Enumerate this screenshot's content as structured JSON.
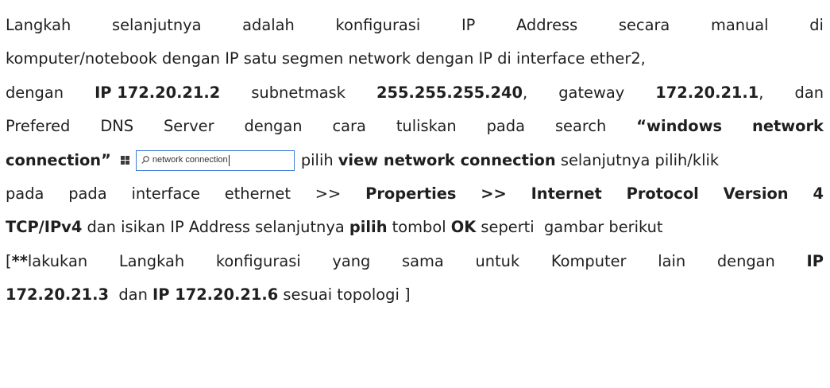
{
  "lines": [
    [
      "Langkah",
      "selanjutnya",
      "adalah",
      "konfigurasi",
      "IP",
      "Address",
      "secara",
      "manual",
      "di"
    ],
    "komputer/notebook dengan IP satu segmen network dengan IP di interface ether2,",
    [
      "dengan",
      "IP 172.20.21.2",
      "subnetmask",
      "255.255.255.240,",
      "gateway",
      "172.20.21.1,",
      "dan"
    ],
    [
      "Prefered",
      "DNS",
      "Server",
      "dengan",
      "cara",
      "tuliskan",
      "pada",
      "search",
      "“windows",
      "network"
    ],
    {
      "before": "connection”",
      "search_text": "network connection",
      "after_bold": "pilih view network connection",
      "after": "selanjutnya pilih/klik"
    },
    [
      "pada",
      "pada",
      "interface",
      "ethernet",
      ">>",
      "Properties >> Internet Protocol Version",
      "4"
    ],
    "TCP/IPv4 dan isikan IP Address selanjutnya pilih tombol OK seperti gambar berikut",
    [
      "[**lakukan",
      "Langkah",
      "konfigurasi",
      "yang",
      "sama",
      "untuk",
      "Komputer",
      "lain",
      "dengan",
      "IP"
    ],
    "172.20.21.3 dan IP 172.20.21.6 sesuai topologi ]"
  ],
  "text": {
    "l1": [
      "Langkah",
      "selanjutnya",
      "adalah",
      "konfigurasi",
      "IP",
      "Address",
      "secara",
      "manual",
      "di"
    ],
    "l2": "komputer/notebook dengan IP satu segmen network dengan IP di interface ether2,",
    "l3": {
      "w1": "dengan",
      "b1": "IP 172.20.21.2",
      "w2": "subnetmask",
      "b2": "255.255.255.240",
      "w3": ",",
      "w4": "gateway",
      "b3": "172.20.21.1",
      "w5": ",",
      "w6": "dan"
    },
    "l4": {
      "words": [
        "Prefered",
        "DNS",
        "Server",
        "dengan",
        "cara",
        "tuliskan",
        "pada",
        "search"
      ],
      "b1": "“windows",
      "b2": "network"
    },
    "l5": {
      "b1": "connection”",
      "search_text": "network connection",
      "w1": "pilih",
      "b2": "view network connection",
      "w2": "selanjutnya pilih/klik"
    },
    "l6": {
      "words": [
        "pada",
        "pada",
        "interface",
        "ethernet",
        ">>"
      ],
      "b1": "Properties",
      "b2": ">>",
      "b3": "Internet",
      "b4": "Protocol",
      "b5": "Version",
      "b6": "4"
    },
    "l7": {
      "b1": "TCP/IPv4",
      "w1": " dan isikan IP Address selanjutnya ",
      "b2": "pilih",
      "w2": " tombol ",
      "b3": "OK",
      "w3": " seperti  gambar berikut"
    },
    "l8": {
      "w1": "[",
      "b1": "**",
      "w2": "lakukan",
      "words": [
        "Langkah",
        "konfigurasi",
        "yang",
        "sama",
        "untuk",
        "Komputer",
        "lain",
        "dengan"
      ],
      "b2": "IP"
    },
    "l9": {
      "b1": "172.20.21.3",
      "w1": "  dan ",
      "b2": "IP 172.20.21.6",
      "w2": " sesuai topologi ]"
    }
  },
  "icons": {
    "windows": "windows-logo-icon",
    "search": "search-icon"
  },
  "colors": {
    "text": "#1f1f1f",
    "search_border": "#3c7fd6"
  }
}
